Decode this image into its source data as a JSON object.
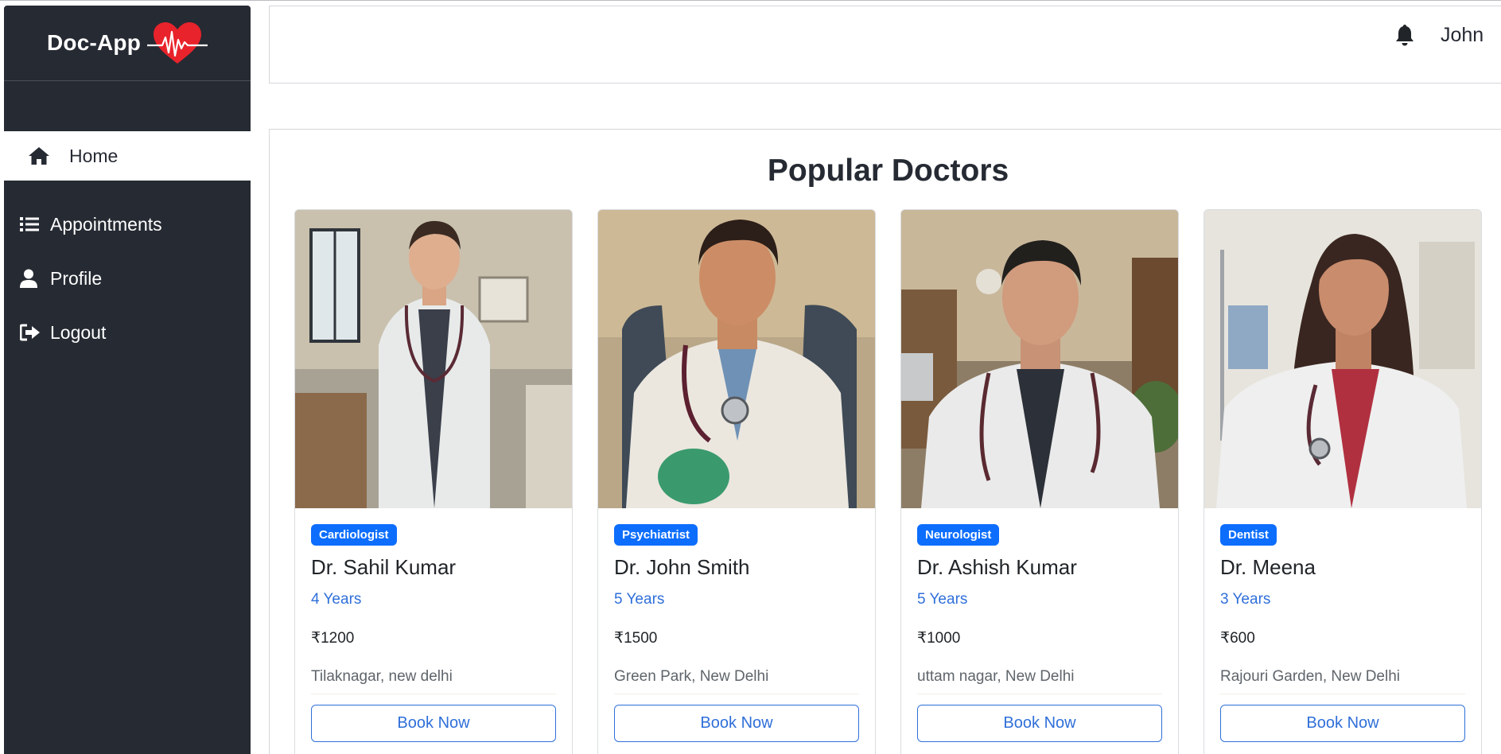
{
  "app": {
    "brand": "Doc-App"
  },
  "sidebar": {
    "items": [
      {
        "label": "Home",
        "icon": "home-icon",
        "active": true
      },
      {
        "label": "Appointments",
        "icon": "list-icon"
      },
      {
        "label": "Profile",
        "icon": "user-icon"
      },
      {
        "label": "Logout",
        "icon": "logout-icon"
      }
    ]
  },
  "header": {
    "user": "John",
    "icon": "bell-icon"
  },
  "main": {
    "title": "Popular Doctors",
    "doctors": [
      {
        "specialty": "Cardiologist",
        "name": "Dr. Sahil Kumar",
        "experience": "4 Years",
        "fee": "₹1200",
        "location": "Tilaknagar, new delhi",
        "cta": "Book Now"
      },
      {
        "specialty": "Psychiatrist",
        "name": "Dr. John Smith",
        "experience": "5 Years",
        "fee": "₹1500",
        "location": "Green Park, New Delhi",
        "cta": "Book Now"
      },
      {
        "specialty": "Neurologist",
        "name": "Dr. Ashish Kumar",
        "experience": "5 Years",
        "fee": "₹1000",
        "location": "uttam nagar, New Delhi",
        "cta": "Book Now"
      },
      {
        "specialty": "Dentist",
        "name": "Dr. Meena",
        "experience": "3 Years",
        "fee": "₹600",
        "location": "Rajouri Garden, New Delhi",
        "cta": "Book Now"
      }
    ]
  },
  "colors": {
    "sidebar": "#262a33",
    "primary": "#0d6efd",
    "link": "#2f6fd9",
    "heart": "#e8232b"
  }
}
